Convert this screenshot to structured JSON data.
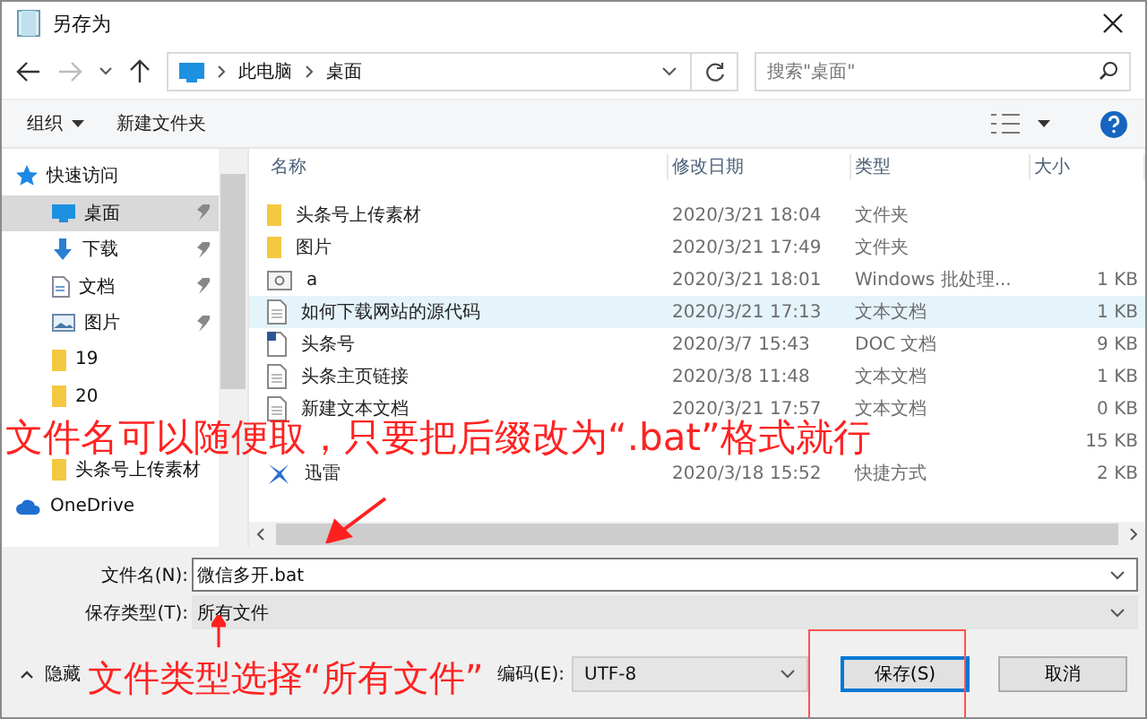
{
  "window": {
    "title": "另存为"
  },
  "nav": {
    "breadcrumb": [
      "此电脑",
      "桌面"
    ],
    "search": {
      "placeholder": "搜索\"桌面\""
    }
  },
  "toolbar": {
    "organize": "组织",
    "new_folder": "新建文件夹"
  },
  "sidebar": {
    "items": [
      {
        "label": "快速访问",
        "kind": "star",
        "selected": false,
        "pinned": false,
        "children": [
          {
            "label": "桌面",
            "kind": "desktop",
            "selected": true,
            "pinned": true
          },
          {
            "label": "下载",
            "kind": "download",
            "selected": false,
            "pinned": true
          },
          {
            "label": "文档",
            "kind": "document",
            "selected": false,
            "pinned": true
          },
          {
            "label": "图片",
            "kind": "picture",
            "selected": false,
            "pinned": true
          },
          {
            "label": "19",
            "kind": "folder",
            "selected": false,
            "pinned": false
          },
          {
            "label": "20",
            "kind": "folder",
            "selected": false,
            "pinned": false
          },
          {
            "label": "头条号上传素材",
            "kind": "folder",
            "selected": false,
            "pinned": false
          }
        ]
      },
      {
        "label": "OneDrive",
        "kind": "cloud",
        "selected": false,
        "pinned": false
      }
    ]
  },
  "table": {
    "columns": [
      "名称",
      "修改日期",
      "类型",
      "大小"
    ],
    "rows": [
      {
        "kind": "folder",
        "name": "头条号上传素材",
        "date": "2020/3/21 18:04",
        "type": "文件夹",
        "selected": false
      },
      {
        "kind": "folder",
        "name": "图片",
        "date": "2020/3/21 17:49",
        "type": "文件夹",
        "selected": false
      },
      {
        "kind": "batch",
        "name": "a",
        "date": "2020/3/21 18:01",
        "type": "Windows 批处理...",
        "size": "1 KB",
        "selected": false
      },
      {
        "kind": "text",
        "name": "如何下载网站的源代码",
        "date": "2020/3/21 17:13",
        "type": "文本文档",
        "size": "1 KB",
        "selected": true
      },
      {
        "kind": "word",
        "name": "头条号",
        "date": "2020/3/7 15:43",
        "type": "DOC 文档",
        "size": "9 KB",
        "selected": false
      },
      {
        "kind": "text",
        "name": "头条主页链接",
        "date": "2020/3/8 11:48",
        "type": "文本文档",
        "size": "1 KB",
        "selected": false
      },
      {
        "kind": "text",
        "name": "新建文本文档",
        "date": "2020/3/21 17:57",
        "type": "文本文档",
        "size": "0 KB",
        "selected": false
      },
      {
        "size": "15 KB",
        "selected": false
      },
      {
        "kind": "shortcut",
        "name": "迅雷",
        "date": "2020/3/18 15:52",
        "type": "快捷方式",
        "size": "2 KB",
        "selected": false
      }
    ]
  },
  "form": {
    "filename": {
      "label": "文件名(N):",
      "value": "微信多开.bat"
    },
    "filetype": {
      "label": "保存类型(T):",
      "value": "所有文件"
    },
    "hide_folders": "隐藏",
    "encoding": {
      "label": "编码(E):",
      "value": "UTF-8"
    },
    "buttons": [
      {
        "label": "保存(S)",
        "kind": "default"
      },
      {
        "label": "取消",
        "kind": "normal"
      }
    ]
  },
  "annotations": [
    {
      "text": "文件名可以随便取，只要把后缀改为“.bat”格式就行"
    },
    {
      "text": "文件类型选择“所有文件”"
    }
  ]
}
